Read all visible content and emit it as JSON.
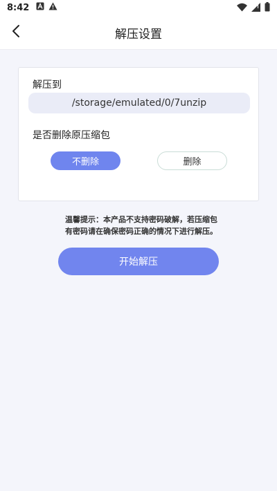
{
  "status_bar": {
    "time": "8:42",
    "icons_left": [
      "app-a-icon",
      "warning-icon"
    ],
    "icons_right": [
      "wifi-icon",
      "signal-icon",
      "battery-icon"
    ]
  },
  "header": {
    "title": "解压设置",
    "back_icon": "chevron-left-icon"
  },
  "extract_settings": {
    "extract_to_label": "解压到",
    "path_value": "/storage/emulated/0/7unzip",
    "delete_question_label": "是否删除原压缩包",
    "option_keep_label": "不删除",
    "option_delete_label": "删除",
    "selected_option": "不删除"
  },
  "tip_text": "温馨提示：本产品不支持密码破解，若压缩包有密码请在确保密码正确的情况下进行解压。",
  "start_button_label": "开始解压",
  "colors": {
    "accent": "#6f85ee",
    "background": "#f4f5fb",
    "field_bg": "#eaecf7"
  }
}
